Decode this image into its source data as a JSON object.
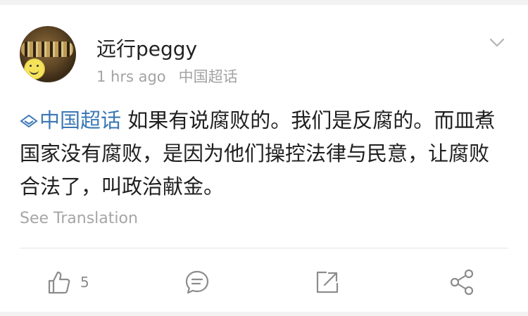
{
  "post": {
    "username": "远行peggy",
    "time": "1 hrs ago",
    "source": "中国超话",
    "topic": "中国超话",
    "text": " 如果有说腐败的。我们是反腐的。而皿煮国家没有腐败，是因为他们操控法律与民意，让腐败合法了，叫政治献金。",
    "see_translation": "See Translation"
  },
  "actions": {
    "like_count": "5"
  },
  "icons": [
    "chevron-down-icon",
    "topic-diamond-icon",
    "thumbs-up-icon",
    "comment-icon",
    "repost-icon",
    "share-icon"
  ],
  "colors": {
    "topic_link": "#3c78b5",
    "meta_text": "#a3a3a3",
    "icon_gray": "#8c8c8c",
    "background": "#f2f2f2"
  }
}
